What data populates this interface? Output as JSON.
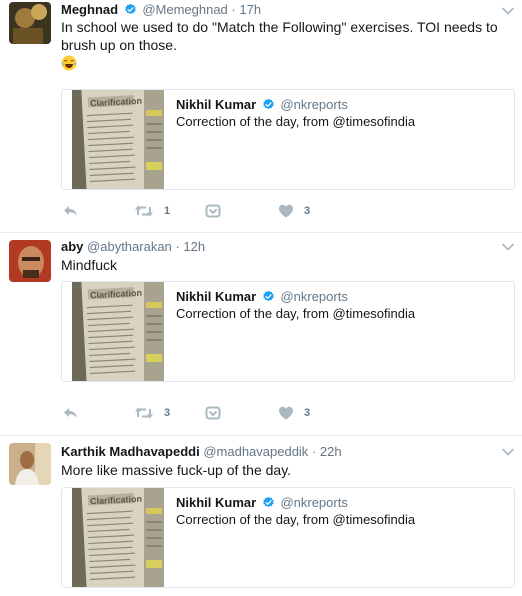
{
  "quoted": {
    "name": "Nikhil Kumar",
    "handle": "@nkreports",
    "text": "Correction of the day, from @timesofindia"
  },
  "tweets": [
    {
      "name": "Meghnad",
      "handle": "@Memeghnad",
      "dot": "·",
      "time": "17h",
      "text": "In school we used to do \"Match the Following\" exercises. TOI needs to brush up on those.",
      "emoji": "face-with-tears-of-joy",
      "retweets": "1",
      "likes": "3"
    },
    {
      "name": "aby",
      "handle": "@abytharakan",
      "dot": "·",
      "time": "12h",
      "text": "Mindfuck",
      "retweets": "3",
      "likes": "3"
    },
    {
      "name": "Karthik Madhavapeddi",
      "handle": "@madhavapeddik",
      "dot": "·",
      "time": "22h",
      "text": "More like massive fuck-up of the day."
    }
  ],
  "icons": {
    "verified": "verified-badge-icon",
    "chevron": "chevron-down-icon",
    "reply": "reply-icon",
    "retweet": "retweet-icon",
    "dm": "direct-message-icon",
    "like": "heart-icon"
  },
  "colors": {
    "accent": "#1da1f2",
    "text": "#14171a",
    "muted": "#657786",
    "action": "#aab8c2",
    "border": "#e1e8ed"
  }
}
